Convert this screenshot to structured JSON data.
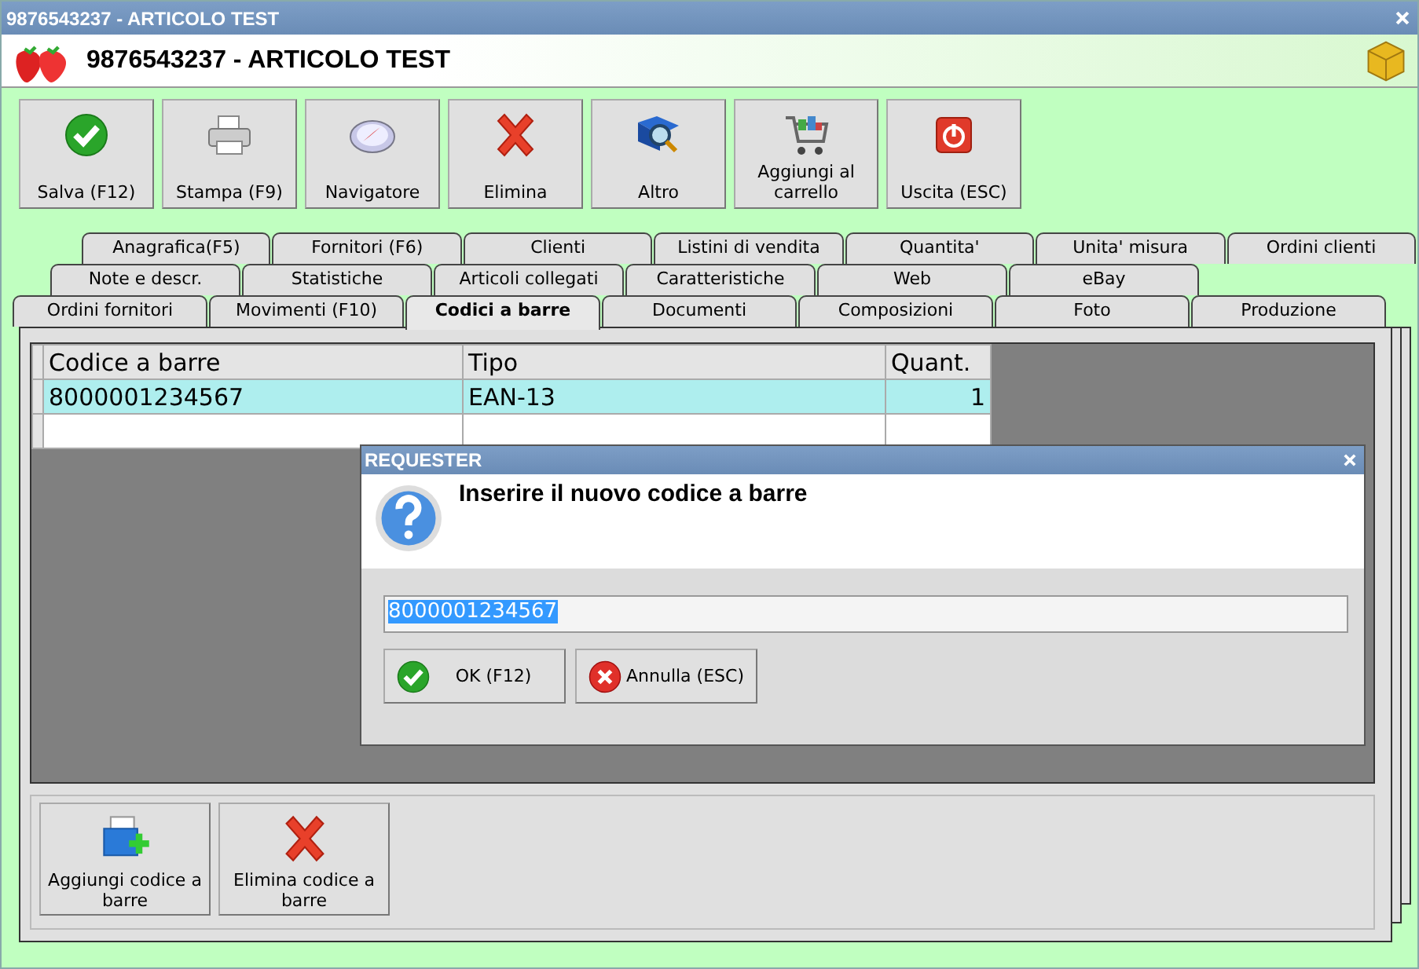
{
  "window": {
    "title": "9876543237 - ARTICOLO TEST"
  },
  "header": {
    "title": "9876543237 - ARTICOLO TEST"
  },
  "toolbar": [
    {
      "label": "Salva (F12)"
    },
    {
      "label": "Stampa (F9)"
    },
    {
      "label": "Navigatore"
    },
    {
      "label": "Elimina"
    },
    {
      "label": "Altro"
    },
    {
      "label": "Aggiungi al carrello"
    },
    {
      "label": "Uscita (ESC)"
    }
  ],
  "tab_rows": [
    [
      {
        "label": "Anagrafica(F5)",
        "selected": false
      },
      {
        "label": "Fornitori (F6)",
        "selected": false
      },
      {
        "label": "Clienti",
        "selected": false
      },
      {
        "label": "Listini di vendita",
        "selected": false
      },
      {
        "label": "Quantita'",
        "selected": false
      },
      {
        "label": "Unita' misura",
        "selected": false
      },
      {
        "label": "Ordini clienti",
        "selected": false
      }
    ],
    [
      {
        "label": "Note e descr.",
        "selected": false
      },
      {
        "label": "Statistiche",
        "selected": false
      },
      {
        "label": "Articoli collegati",
        "selected": false
      },
      {
        "label": "Caratteristiche",
        "selected": false
      },
      {
        "label": "Web",
        "selected": false
      },
      {
        "label": "eBay",
        "selected": false
      }
    ],
    [
      {
        "label": "Ordini fornitori",
        "selected": false
      },
      {
        "label": "Movimenti (F10)",
        "selected": false
      },
      {
        "label": "Codici a barre",
        "selected": true
      },
      {
        "label": "Documenti",
        "selected": false
      },
      {
        "label": "Composizioni",
        "selected": false
      },
      {
        "label": "Foto",
        "selected": false
      },
      {
        "label": "Produzione",
        "selected": false
      }
    ]
  ],
  "table": {
    "columns": [
      "Codice a barre",
      "Tipo",
      "Quant."
    ],
    "rows": [
      {
        "cells": [
          "8000001234567",
          "EAN-13",
          "1"
        ],
        "selected": true
      }
    ]
  },
  "actions": [
    {
      "label": "Aggiungi codice a barre"
    },
    {
      "label": "Elimina codice a barre"
    }
  ],
  "dialog": {
    "title": "REQUESTER",
    "message": "Inserire il nuovo codice a barre",
    "input": {
      "value": "8000001234567",
      "text_selected": true
    },
    "buttons": [
      {
        "label": "OK (F12)"
      },
      {
        "label": "Annulla (ESC)"
      }
    ]
  }
}
